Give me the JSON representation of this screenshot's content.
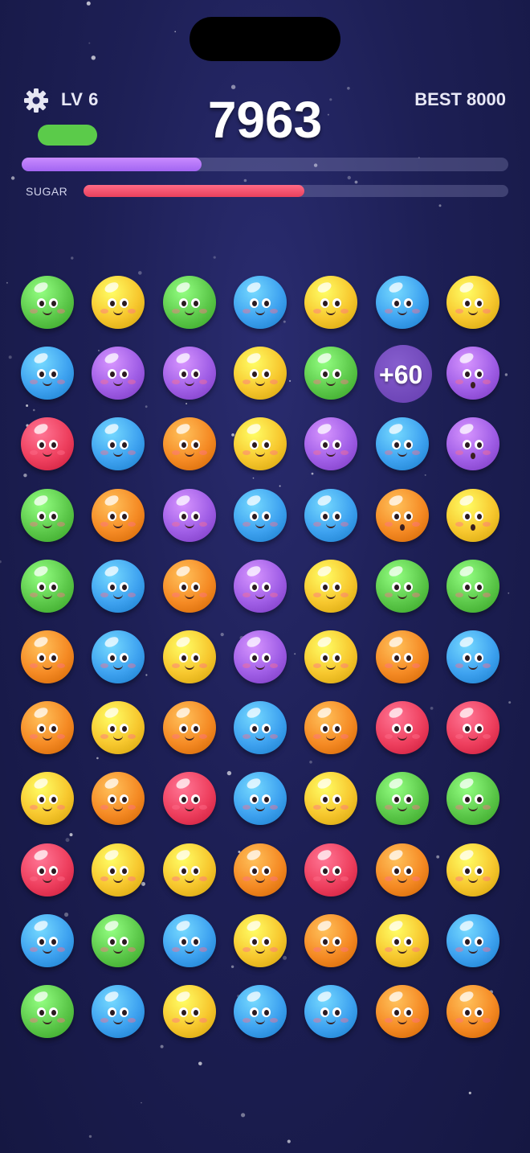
{
  "header": {
    "level_label": "LV 6",
    "score": "7963",
    "best_label": "BEST 8000",
    "level_progress": 0.37,
    "sugar_label": "SUGAR",
    "sugar_progress": 0.52
  },
  "icons": {
    "settings": "gear-icon"
  },
  "colors": {
    "green": "#5cc84a",
    "yellow": "#f7c72e",
    "blue": "#3ea2f0",
    "purple": "#a05ee6",
    "red": "#ee3f5e",
    "orange": "#f58a24",
    "level_pill": "#5bcb4a",
    "progress": "#b177f7",
    "sugar": "#ee4864"
  },
  "board": {
    "rows": [
      [
        "green",
        "yellow",
        "green",
        "blue",
        "yellow",
        "blue",
        "yellow"
      ],
      [
        "blue",
        "purple",
        "purple",
        "yellow",
        "green",
        "purple",
        "purple"
      ],
      [
        "red",
        "blue",
        "orange",
        "yellow",
        "purple",
        "blue",
        "purple"
      ],
      [
        "green",
        "orange",
        "purple",
        "blue",
        "blue",
        "orange",
        "yellow"
      ],
      [
        "green",
        "blue",
        "orange",
        "purple",
        "yellow",
        "green",
        "green"
      ],
      [
        "orange",
        "blue",
        "yellow",
        "purple",
        "yellow",
        "orange",
        "blue"
      ],
      [
        "orange",
        "yellow",
        "orange",
        "blue",
        "orange",
        "red",
        "red"
      ],
      [
        "yellow",
        "orange",
        "red",
        "blue",
        "yellow",
        "green",
        "green"
      ],
      [
        "red",
        "yellow",
        "yellow",
        "orange",
        "red",
        "orange",
        "yellow"
      ],
      [
        "blue",
        "green",
        "blue",
        "yellow",
        "orange",
        "yellow",
        "blue"
      ],
      [
        "green",
        "blue",
        "yellow",
        "blue",
        "blue",
        "orange",
        "orange"
      ]
    ],
    "surprised": [
      [
        1,
        6
      ],
      [
        2,
        6
      ],
      [
        3,
        5
      ],
      [
        3,
        6
      ]
    ]
  },
  "popup": {
    "text": "+60"
  }
}
